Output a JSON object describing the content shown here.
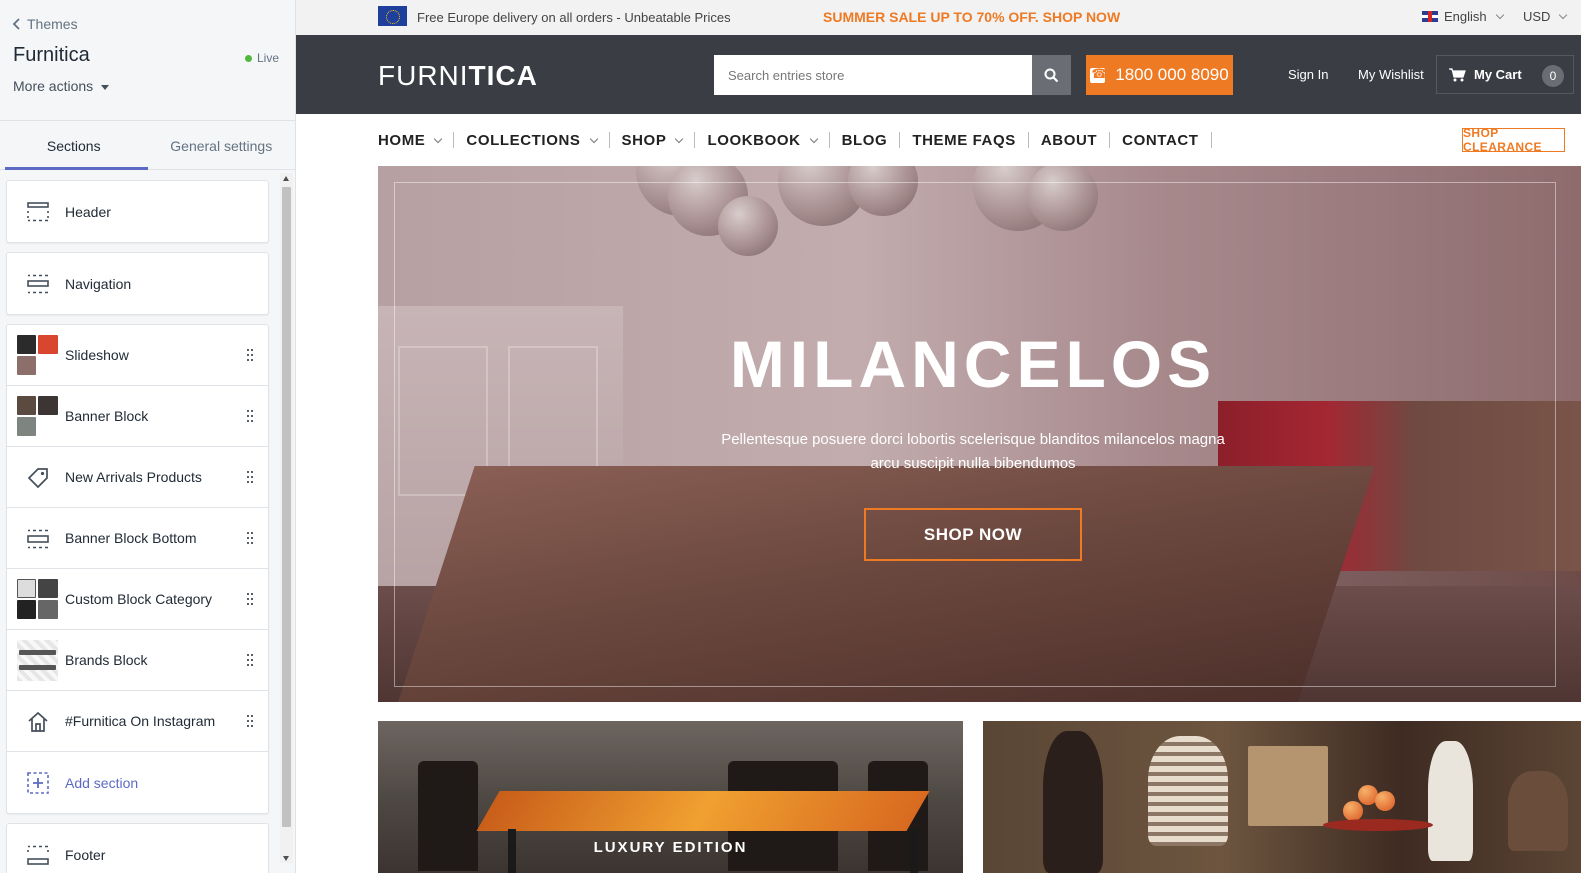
{
  "editor": {
    "back_label": "Themes",
    "theme_name": "Furnitica",
    "status": "Live",
    "more_actions": "More actions",
    "tabs": [
      {
        "label": "Sections",
        "active": true
      },
      {
        "label": "General settings",
        "active": false
      }
    ],
    "sections_top": [
      {
        "label": "Header",
        "icon": "header-layout-icon"
      },
      {
        "label": "Navigation",
        "icon": "navigation-layout-icon"
      }
    ],
    "sections": [
      {
        "label": "Slideshow",
        "icon": "slideshow-thumbnail"
      },
      {
        "label": "Banner Block",
        "icon": "banner-thumbnail"
      },
      {
        "label": "New Arrivals Products",
        "icon": "tag-icon"
      },
      {
        "label": "Banner Block Bottom",
        "icon": "banner-layout-icon"
      },
      {
        "label": "Custom Block Category",
        "icon": "category-thumbnail"
      },
      {
        "label": "Brands Block",
        "icon": "brands-thumbnail"
      },
      {
        "label": "#Furnitica On Instagram",
        "icon": "home-icon"
      }
    ],
    "add_section": "Add section",
    "footer": {
      "label": "Footer",
      "icon": "footer-layout-icon"
    }
  },
  "store": {
    "topbar": {
      "delivery": "Free Europe delivery on all orders - Unbeatable Prices",
      "sale": "SUMMER SALE UP TO 70% OFF. SHOP NOW",
      "language": "English",
      "currency": "USD"
    },
    "header": {
      "logo_light": "FURNI",
      "logo_bold": "TICA",
      "search_placeholder": "Search entries store",
      "phone": "1800 000 8090",
      "sign_in": "Sign In",
      "wishlist": "My Wishlist",
      "cart_label": "My Cart",
      "cart_count": "0"
    },
    "nav": [
      {
        "label": "HOME",
        "dropdown": true
      },
      {
        "label": "COLLECTIONS",
        "dropdown": true
      },
      {
        "label": "SHOP",
        "dropdown": true
      },
      {
        "label": "LOOKBOOK",
        "dropdown": true
      },
      {
        "label": "BLOG",
        "dropdown": false
      },
      {
        "label": "THEME FAQS",
        "dropdown": false
      },
      {
        "label": "ABOUT",
        "dropdown": false
      },
      {
        "label": "CONTACT",
        "dropdown": false
      }
    ],
    "shop_clearance": "SHOP CLEARANCE",
    "hero": {
      "title": "MILANCELOS",
      "subtitle": "Pellentesque posuere dorci lobortis scelerisque blanditos milancelos magna arcu suscipit nulla bibendumos",
      "button": "SHOP NOW"
    },
    "banners": [
      {
        "label": "LUXURY EDITION"
      }
    ]
  },
  "colors": {
    "accent_orange": "#ef7a24",
    "header_dark": "#3a3d44",
    "editor_accent": "#5c6ac4",
    "live_green": "#50b83c"
  }
}
